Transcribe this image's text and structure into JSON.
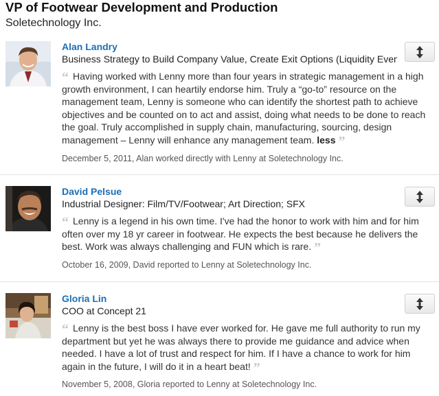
{
  "position": {
    "title": "VP of Footwear Development and Production",
    "company": "Soletechnology Inc."
  },
  "recommendations": [
    {
      "name": "Alan Landry",
      "headline": "Business Strategy to Build Company Value, Create Exit Options (Liquidity Events)",
      "text": "Having worked with Lenny more than four years in strategic management in a high growth environment, I can heartily endorse him. Truly a “go-to” resource on the management team, Lenny is someone who can identify the shortest path to achieve objectives and be counted on to act and assist, doing what needs to be done to reach the goal. Truly accomplished in supply chain, manufacturing, sourcing, design management – Lenny will enhance any management team.",
      "less_label": "less",
      "meta": "December 5, 2011, Alan worked directly with Lenny at Soletechnology Inc."
    },
    {
      "name": "David Pelsue",
      "headline": "Industrial Designer: Film/TV/Footwear; Art Direction; SFX",
      "text": "Lenny is a legend in his own time. I've had the honor to work with him and for him often over my 18 yr career in footwear. He expects the best because he delivers the best. Work was always challenging and FUN which is rare.",
      "meta": "October 16, 2009, David reported to Lenny at Soletechnology Inc."
    },
    {
      "name": "Gloria Lin",
      "headline": "COO at Concept 21",
      "text": "Lenny is the best boss I have ever worked for. He gave me full authority to run my department but yet he was always there to provide me guidance and advice when needed. I have a lot of trust and respect for him. If I have a chance to work for him again in the future, I will do it in a heart beat!",
      "meta": "November 5, 2008, Gloria reported to Lenny at Soletechnology Inc."
    }
  ],
  "icons": {
    "reorder": "up-down-arrows-icon",
    "quote_open": "open-quote-icon",
    "quote_close": "close-quote-icon"
  },
  "colors": {
    "name_link": "#1b6eb5",
    "quote_marks": "#c8c8c8",
    "meta_text": "#555555"
  }
}
